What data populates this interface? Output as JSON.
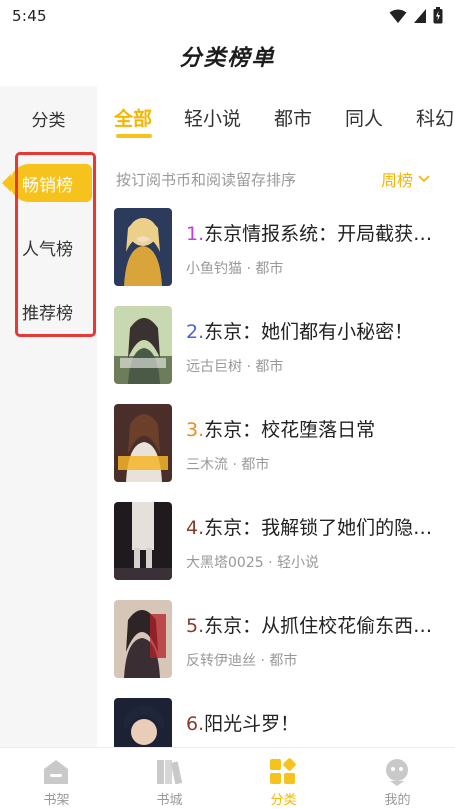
{
  "status_bar": {
    "time": "5:45"
  },
  "header": {
    "title": "分类榜单"
  },
  "sidebar": {
    "head": "分类",
    "items": [
      {
        "label": "畅销榜",
        "active": true
      },
      {
        "label": "人气榜",
        "active": false
      },
      {
        "label": "推荐榜",
        "active": false
      }
    ]
  },
  "tabs": [
    "全部",
    "轻小说",
    "都市",
    "同人",
    "科幻"
  ],
  "sort": {
    "hint": "按订阅书币和阅读留存排序",
    "period": "周榜"
  },
  "books": [
    {
      "rank": "1.",
      "title": "东京情报系统：开局截获三大...",
      "author": "小鱼钓猫",
      "genre": "都市",
      "rank_color": "#c040e0"
    },
    {
      "rank": "2.",
      "title": "东京：她们都有小秘密！",
      "author": "远古巨树",
      "genre": "都市",
      "rank_color": "#4a63d8"
    },
    {
      "rank": "3.",
      "title": "东京：校花堕落日常",
      "author": "三木流",
      "genre": "都市",
      "rank_color": "#f08a1c"
    },
    {
      "rank": "4.",
      "title": "东京：我解锁了她们的隐藏剧情",
      "author": "大黑塔0025",
      "genre": "轻小说",
      "rank_color": "#8b3a2a"
    },
    {
      "rank": "5.",
      "title": "东京：从抓住校花偷东西开始",
      "author": "反转伊迪丝",
      "genre": "都市",
      "rank_color": "#8b3a2a"
    },
    {
      "rank": "6.",
      "title": "阳光斗罗！",
      "author": "",
      "genre": "",
      "rank_color": "#8b3a2a"
    }
  ],
  "meta_separator": " · ",
  "bottom_nav": [
    {
      "label": "书架",
      "icon": "bookshelf-icon",
      "active": false
    },
    {
      "label": "书城",
      "icon": "bookstore-icon",
      "active": false
    },
    {
      "label": "分类",
      "icon": "category-icon",
      "active": true
    },
    {
      "label": "我的",
      "icon": "profile-icon",
      "active": false
    }
  ],
  "colors": {
    "accent": "#f7c21b",
    "accent_text": "#f7b500",
    "highlight_box": "#e53935"
  }
}
